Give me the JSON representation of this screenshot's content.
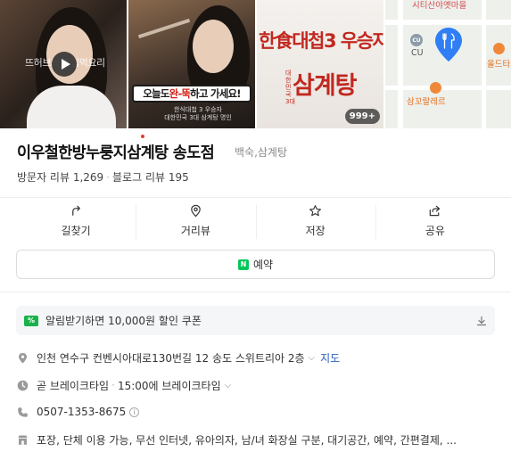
{
  "gallery": {
    "video_caption": "뜨허브의 맛집먹요리",
    "banner_parts": [
      "오늘도 ",
      "완-뚝",
      " 하고 가세요!"
    ],
    "sub_caption": "한식대첩 3 우승자\n대한민국 3대 삼계탕 명인",
    "sign_line1": "한食대첩3 우승자",
    "sign_line2": "삼계탕",
    "sign_sub": "대한민국\n3대",
    "photo_count": "999+",
    "map_labels": {
      "top": "시티산야옛마을",
      "cu": "CU",
      "cu_badge": "CU",
      "right": "올드타",
      "bottom": "삼꼬랄레르"
    }
  },
  "place": {
    "name": "이우철한방누룽지삼계탕 송도점",
    "category": "백숙,삼계탕",
    "visitor_reviews": "방문자 리뷰 1,269",
    "blog_reviews": "블로그 리뷰 195"
  },
  "actions": [
    {
      "label": "길찾기",
      "icon": "directions-icon"
    },
    {
      "label": "거리뷰",
      "icon": "street-view-icon"
    },
    {
      "label": "저장",
      "icon": "star-icon"
    },
    {
      "label": "공유",
      "icon": "share-icon"
    }
  ],
  "reserve": {
    "label": "예약",
    "badge": "N"
  },
  "coupon": {
    "label": "알림받기하면 10,000원 할인 쿠폰",
    "badge": "%"
  },
  "info": {
    "address": "인천 연수구 컨벤시아대로130번길 12 송도 스위트리아 2층",
    "map_link": "지도",
    "status": "곧 브레이크타임",
    "status_detail": "15:00에 브레이크타임",
    "phone": "0507-1353-8675",
    "info_glyph": "i",
    "amenities": "포장, 단체 이용 가능, 무선 인터넷, 유아의자, 남/녀 화장실 구분, 대기공간, 예약, 간편결제, ..."
  },
  "colors": {
    "accent_green": "#03c75a",
    "coupon_green": "#19b24b",
    "link_blue": "#2b63c5",
    "map_pin": "#2f7ef5",
    "active_dot": "#e53b2e"
  }
}
